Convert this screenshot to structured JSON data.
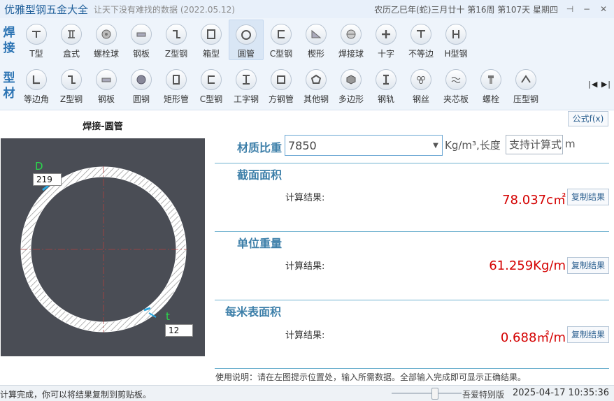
{
  "titlebar": {
    "app_title": "优雅型钢五金大全",
    "subtitle": "让天下没有难找的数据 (2022.05.12)",
    "calendar": "农历乙巳年(蛇)三月廿十 第16周 第107天 星期四",
    "pin_icon": "pin-icon",
    "min_icon": "minimize-icon",
    "close_icon": "close-icon"
  },
  "toolbar": {
    "group1_label": [
      "焊",
      "接"
    ],
    "group2_label": [
      "型",
      "材"
    ],
    "row1": [
      {
        "label": "T型",
        "icon": "t-shape-icon"
      },
      {
        "label": "盒式",
        "icon": "box-icon"
      },
      {
        "label": "螺栓球",
        "icon": "bolt-ball-icon"
      },
      {
        "label": "钢板",
        "icon": "plate-icon"
      },
      {
        "label": "Z型钢",
        "icon": "z-steel-icon"
      },
      {
        "label": "箱型",
        "icon": "box-section-icon"
      },
      {
        "label": "圆管",
        "icon": "round-tube-icon",
        "active": true
      },
      {
        "label": "C型钢",
        "icon": "c-steel-icon"
      },
      {
        "label": "楔形",
        "icon": "wedge-icon"
      },
      {
        "label": "焊接球",
        "icon": "weld-ball-icon"
      },
      {
        "label": "十字",
        "icon": "cross-icon"
      },
      {
        "label": "不等边",
        "icon": "unequal-angle-icon"
      },
      {
        "label": "H型钢",
        "icon": "h-steel-icon"
      }
    ],
    "row2": [
      {
        "label": "等边角",
        "icon": "equal-angle-icon"
      },
      {
        "label": "Z型钢",
        "icon": "z-steel-icon"
      },
      {
        "label": "钢板",
        "icon": "plate-icon"
      },
      {
        "label": "圆钢",
        "icon": "round-bar-icon"
      },
      {
        "label": "矩形管",
        "icon": "rect-tube-icon"
      },
      {
        "label": "C型钢",
        "icon": "c-steel-icon"
      },
      {
        "label": "工字钢",
        "icon": "i-beam-icon"
      },
      {
        "label": "方钢管",
        "icon": "square-tube-icon"
      },
      {
        "label": "其他钢",
        "icon": "other-steel-icon"
      },
      {
        "label": "多边形",
        "icon": "polygon-icon"
      },
      {
        "label": "钢轨",
        "icon": "rail-icon"
      },
      {
        "label": "钢丝",
        "icon": "wire-icon"
      },
      {
        "label": "夹芯板",
        "icon": "sandwich-panel-icon"
      },
      {
        "label": "螺栓",
        "icon": "bolt-icon"
      },
      {
        "label": "压型钢",
        "icon": "profiled-steel-icon"
      }
    ],
    "scroll_arrows": "|◀ ▶|"
  },
  "diagram": {
    "title": "焊接-圆管",
    "d_label": "D",
    "d_value": "219",
    "t_label": "t",
    "t_value": "12"
  },
  "form": {
    "formula_button": "公式f(x)",
    "density_label": "材质比重",
    "density_value": "7850",
    "density_unit": "Kg/m³,长度",
    "length_placeholder": "支持计算式",
    "length_unit": "m"
  },
  "sections": [
    {
      "title": "截面面积",
      "calc_label": "计算结果:",
      "result": "78.037c㎡",
      "copy": "复制结果"
    },
    {
      "title": "单位重量",
      "calc_label": "计算结果:",
      "result": "61.259Kg/m",
      "copy": "复制结果"
    },
    {
      "title": "每米表面积",
      "calc_label": "计算结果:",
      "result": "0.688㎡/m",
      "copy": "复制结果"
    }
  ],
  "usage": "使用说明：请在左图提示位置处，输入所需数据。全部输入完成即可显示正确结果。",
  "statusbar": {
    "message": "计算完成，你可以将结果复制到剪贴板。",
    "edition": "吾爱特别版",
    "datetime": "2025-04-17 10:35:36"
  }
}
